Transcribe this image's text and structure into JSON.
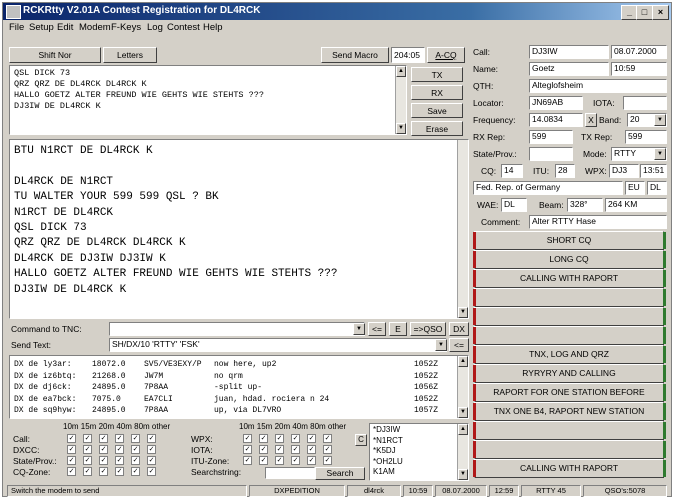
{
  "window": {
    "title": "RCKRtty V2.01A Contest Registration for DL4RCK"
  },
  "menu": [
    "File",
    "Setup",
    "Edit",
    "Modem",
    "F-Keys",
    "Log",
    "Contest",
    "Help"
  ],
  "toolbar": {
    "shift_label": "Shift Nor",
    "letters_label": "Letters",
    "send_macro_label": "Send Macro",
    "time": "204:05",
    "acq_label": "A-CQ"
  },
  "tx_buttons": {
    "tx": "TX",
    "rx": "RX",
    "save": "Save",
    "erase": "Erase"
  },
  "tx_text": "QSL DICK 73\nQRZ QRZ DE DL4RCK DL4RCK K\nHALLO GOETZ ALTER FREUND WIE GEHTS WIE STEHTS ???\nDJ3IW DE DL4RCK K",
  "rx_text": "BTU N1RCT DE DL4RCK K\n\nDL4RCK DE N1RCT\nTU WALTER YOUR 599 599 QSL ? BK\nN1RCT DE DL4RCK\nQSL DICK 73\nQRZ QRZ DE DL4RCK DL4RCK K\nDL4RCK DE DJ3IW DJ3IW K\nHALLO GOETZ ALTER FREUND WIE GEHTS WIE STEHTS ???\nDJ3IW DE DL4RCK K",
  "command": {
    "label": "Command to TNC:",
    "value": "",
    "btn_lt": "<=",
    "btn_e": "E",
    "btn_qso": "=>QSO",
    "btn_dx": "DX"
  },
  "send_text": {
    "label": "Send Text:",
    "value": "SH/DX/10 'RTTY' 'FSK'",
    "btn": "<="
  },
  "dx_spots": [
    {
      "de": "DX de ly3ar:",
      "freq": "18072.0",
      "call": "SV5/VE3EXY/P",
      "comment": "now here, up2",
      "time": "1052Z"
    },
    {
      "de": "DX de iz6btq:",
      "freq": "21268.0",
      "call": "JW7M",
      "comment": "no qrm",
      "time": "1052Z"
    },
    {
      "de": "DX de dj6ck:",
      "freq": "24895.0",
      "call": "7P8AA",
      "comment": "-split up-",
      "time": "1056Z"
    },
    {
      "de": "DX de ea7bck:",
      "freq": "7075.0",
      "call": "EA7CLI",
      "comment": "juan, hdad. rociera n  24",
      "time": "1052Z"
    },
    {
      "de": "DX de sq9hyw:",
      "freq": "24895.0",
      "call": "7P8AA",
      "comment": "up, via DL7VRO",
      "time": "1057Z"
    }
  ],
  "bands_header": "10m 15m 20m 40m 80m   other",
  "bands_header_right": "10m 15m 20m 40m 80m   other",
  "filters_left": [
    "Call:",
    "DXCC:",
    "State/Prov.:",
    "CQ-Zone:"
  ],
  "filters_right": [
    "WPX:",
    "IOTA:",
    "ITU-Zone:",
    "Searchstring:"
  ],
  "search_label": "Search",
  "c_label": "C",
  "call_list": [
    "*DJ3IW",
    "*N1RCT",
    "*K5DJ",
    "*OH2LU",
    "K1AM"
  ],
  "log": {
    "call_label": "Call:",
    "call": "DJ3IW",
    "date": "08.07.2000",
    "name_label": "Name:",
    "name": "Goetz",
    "time": "10:59",
    "qth_label": "QTH:",
    "qth": "Alteglofsheim",
    "locator_label": "Locator:",
    "locator": "JN69AB",
    "iota_label": "IOTA:",
    "iota": "",
    "freq_label": "Frequency:",
    "freq": "14.0834",
    "x_label": "X",
    "band_label": "Band:",
    "band": "20",
    "rxrep_label": "RX Rep:",
    "rxrep": "599",
    "txrep_label": "TX Rep:",
    "txrep": "599",
    "state_label": "State/Prov.:",
    "state": "",
    "mode_label": "Mode:",
    "mode": "RTTY",
    "cq_label": "CQ:",
    "cq": "14",
    "itu_label": "ITU:",
    "itu": "28",
    "wpx_label": "WPX:",
    "wpx": "DJ3",
    "wpx_time": "13:51",
    "country": "Fed. Rep. of Germany",
    "continent": "EU",
    "prefix": "DL",
    "wae_label": "WAE:",
    "wae": "DL",
    "beam_label": "Beam:",
    "beam": "328°",
    "dist": "264 KM",
    "comment_label": "Comment:",
    "comment": "Alter RTTY Hase"
  },
  "macros": [
    "SHORT CQ",
    "LONG CQ",
    "CALLING WITH RAPORT",
    "",
    "",
    "",
    "TNX, LOG AND QRZ",
    "RYRYRY AND CALLING",
    "RAPORT FOR ONE STATION BEFORE",
    "TNX ONE B4, RAPORT NEW STATION",
    "",
    "",
    "CALLING WITH RAPORT"
  ],
  "statusbar": {
    "hint": "Switch the modem to send",
    "dxpedition": "DXPEDITION",
    "own_call": "dl4rck",
    "utc": "10:59",
    "date": "08.07.2000",
    "local": "12:59",
    "mode": "RTTY 45",
    "qsos": "QSO's:5078"
  }
}
